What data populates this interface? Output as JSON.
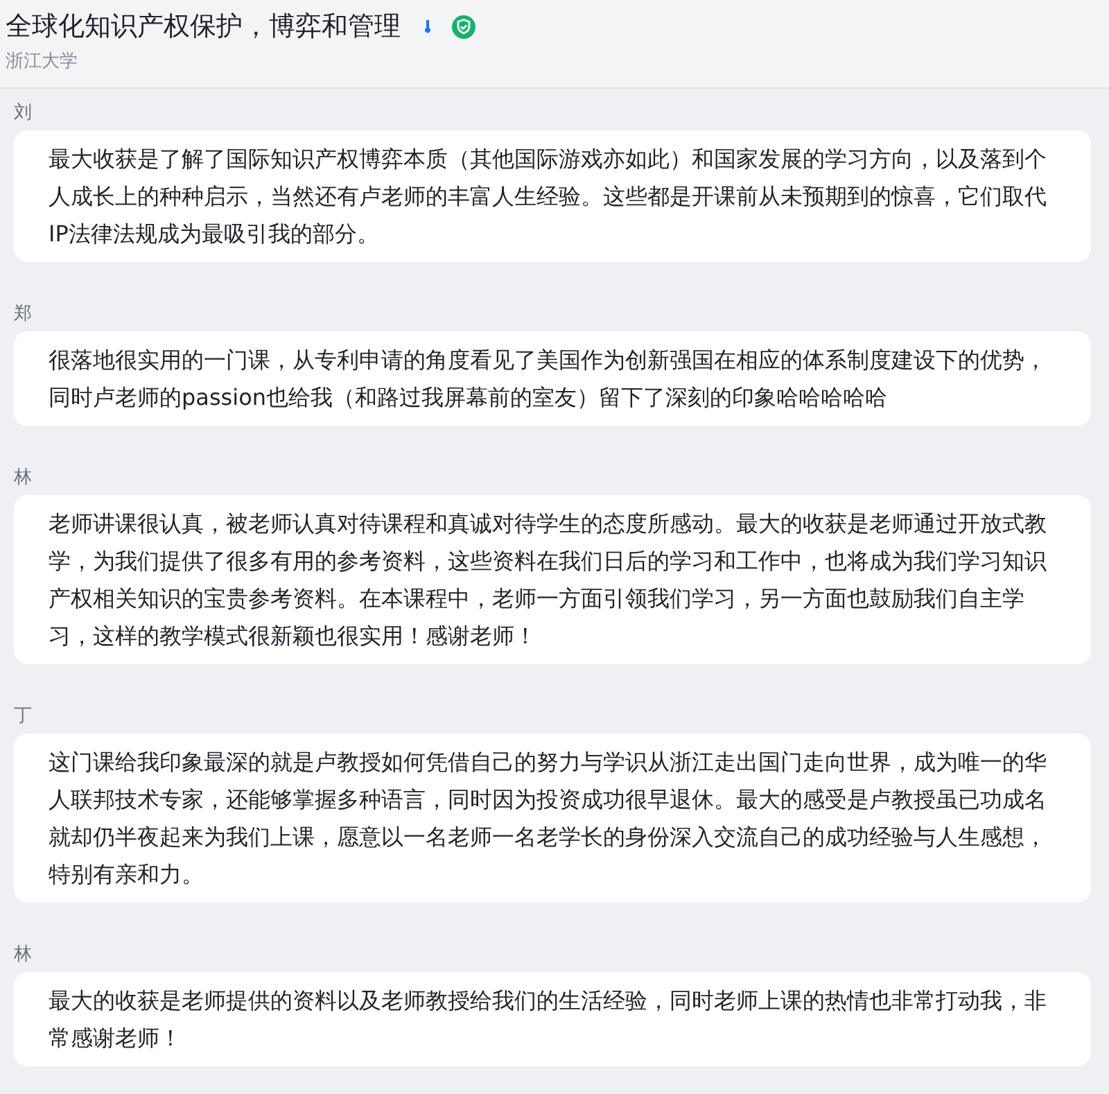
{
  "course": {
    "title": "全球化知识产权保护，博弈和管理",
    "school": "浙江大学"
  },
  "comments": [
    {
      "author": "刘",
      "text": "最大收获是了解了国际知识产权博弈本质（其他国际游戏亦如此）和国家发展的学习方向，以及落到个人成长上的种种启示，当然还有卢老师的丰富人生经验。这些都是开课前从未预期到的惊喜，它们取代IP法律法规成为最吸引我的部分。"
    },
    {
      "author": "郑",
      "text": "很落地很实用的一门课，从专利申请的角度看见了美国作为创新强国在相应的体系制度建设下的优势，同时卢老师的passion也给我（和路过我屏幕前的室友）留下了深刻的印象哈哈哈哈哈"
    },
    {
      "author": "林",
      "text": "老师讲课很认真，被老师认真对待课程和真诚对待学生的态度所感动。最大的收获是老师通过开放式教学，为我们提供了很多有用的参考资料，这些资料在我们日后的学习和工作中，也将成为我们学习知识产权相关知识的宝贵参考资料。在本课程中，老师一方面引领我们学习，另一方面也鼓励我们自主学习，这样的教学模式很新颖也很实用！感谢老师！"
    },
    {
      "author": "丁",
      "text": "这门课给我印象最深的就是卢教授如何凭借自己的努力与学识从浙江走出国门走向世界，成为唯一的华人联邦技术专家，还能够掌握多种语言，同时因为投资成功很早退休。最大的感受是卢教授虽已功成名就却仍半夜起来为我们上课，愿意以一名老师一名老学长的身份深入交流自己的成功经验与人生感想，特别有亲和力。"
    },
    {
      "author": "林",
      "text": "最大的收获是老师提供的资料以及老师教授给我们的生活经验，同时老师上课的热情也非常打动我，非常感谢老师！"
    }
  ]
}
